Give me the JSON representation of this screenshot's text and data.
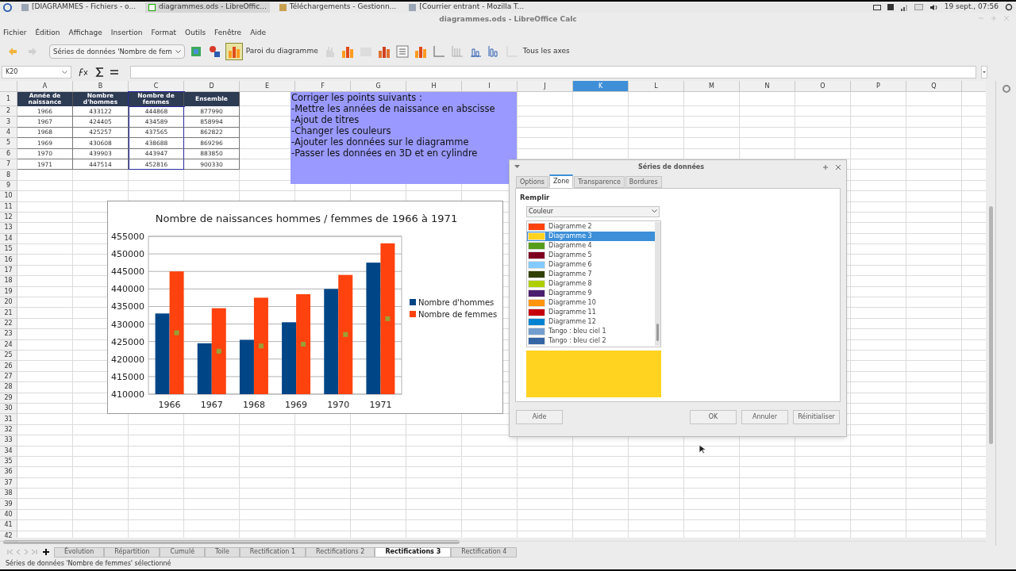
{
  "taskbar": {
    "windows": [
      {
        "label": "[DIAGRAMMES - Fichiers - o...",
        "selected": false
      },
      {
        "label": "diagrammes.ods - LibreOffic...",
        "selected": true
      },
      {
        "label": "Téléchargements - Gestionn...",
        "selected": false
      },
      {
        "label": "[Courrier entrant - Mozilla T...",
        "selected": false
      }
    ],
    "clock": "19 sept., 07:56"
  },
  "window": {
    "title": "diagrammes.ods - LibreOffice Calc"
  },
  "menu": [
    "Fichier",
    "Édition",
    "Affichage",
    "Insertion",
    "Format",
    "Outils",
    "Fenêtre",
    "Aide"
  ],
  "toolbar": {
    "element_select": "Séries de données 'Nombre de fem",
    "wall_label": "Paroi du diagramme",
    "axes_label": "Tous les axes"
  },
  "formula_bar": {
    "cell_ref": "K20"
  },
  "sheet": {
    "columns": [
      {
        "label": "A",
        "selected": false
      },
      {
        "label": "B",
        "selected": false
      },
      {
        "label": "C",
        "selected": false
      },
      {
        "label": "D",
        "selected": false
      },
      {
        "label": "E",
        "selected": false
      },
      {
        "label": "F",
        "selected": false
      },
      {
        "label": "G",
        "selected": false
      },
      {
        "label": "H",
        "selected": false
      },
      {
        "label": "I",
        "selected": false
      },
      {
        "label": "J",
        "selected": false
      },
      {
        "label": "K",
        "selected": true
      },
      {
        "label": "L",
        "selected": false
      },
      {
        "label": "M",
        "selected": false
      },
      {
        "label": "N",
        "selected": false
      },
      {
        "label": "O",
        "selected": false
      },
      {
        "label": "P",
        "selected": false
      },
      {
        "label": "Q",
        "selected": false
      }
    ],
    "rows": [
      "1",
      "2",
      "3",
      "4",
      "5",
      "6",
      "7",
      "8",
      "9",
      "10",
      "11",
      "12",
      "13",
      "14",
      "15",
      "16",
      "17",
      "18",
      "19",
      "20",
      "21",
      "22",
      "23",
      "24",
      "25",
      "26",
      "27",
      "28",
      "29",
      "30",
      "31",
      "32",
      "33",
      "34",
      "35",
      "36",
      "37",
      "38",
      "39",
      "40",
      "41",
      "42"
    ],
    "table": {
      "header": [
        "Année de naissance",
        "Nombre d'hommes",
        "Nombre de femmes",
        "Ensemble"
      ],
      "body": [
        [
          "1966",
          "433122",
          "444868",
          "877990"
        ],
        [
          "1967",
          "424405",
          "434589",
          "858994"
        ],
        [
          "1968",
          "425257",
          "437565",
          "862822"
        ],
        [
          "1969",
          "430608",
          "438688",
          "869296"
        ],
        [
          "1970",
          "439903",
          "443947",
          "883850"
        ],
        [
          "1971",
          "447514",
          "452816",
          "900330"
        ]
      ]
    },
    "note": [
      "Corriger les points suivants :",
      "-Mettre les années de naissance en abscisse",
      "-Ajout de titres",
      "-Changer les couleurs",
      "-Ajouter les données sur le diagramme",
      "-Passer les données en 3D et en cylindre"
    ],
    "chart": {
      "chart_data": {
        "type": "bar",
        "title": "Nombre de naissances hommes / femmes de 1966 à 1971",
        "categories": [
          "1966",
          "1967",
          "1968",
          "1969",
          "1970",
          "1971"
        ],
        "series": [
          {
            "name": "Nombre d'hommes",
            "color": "#004586",
            "values": [
              433000,
              424500,
              425500,
              430500,
              440000,
              447500
            ]
          },
          {
            "name": "Nombre de femmes",
            "color": "#ff420e",
            "values": [
              445000,
              434500,
              437500,
              438500,
              444000,
              453000
            ]
          }
        ],
        "grid": true,
        "legend": true,
        "ylim": [
          410000,
          455000
        ],
        "yticks": [
          410000,
          415000,
          420000,
          425000,
          430000,
          435000,
          440000,
          445000,
          450000,
          455000
        ]
      }
    }
  },
  "dialog": {
    "title": "Séries de données",
    "tabs": [
      {
        "label": "Options",
        "selected": false
      },
      {
        "label": "Zone",
        "selected": true
      },
      {
        "label": "Transparence",
        "selected": false
      },
      {
        "label": "Bordures",
        "selected": false
      }
    ],
    "section": "Remplir",
    "fill_type": "Couleur",
    "colors": [
      {
        "name": "Diagramme 2",
        "color": "#ff420e",
        "selected": false
      },
      {
        "name": "Diagramme 3",
        "color": "#ffd320",
        "selected": true
      },
      {
        "name": "Diagramme 4",
        "color": "#579d1c",
        "selected": false
      },
      {
        "name": "Diagramme 5",
        "color": "#7e0021",
        "selected": false
      },
      {
        "name": "Diagramme 6",
        "color": "#83caff",
        "selected": false
      },
      {
        "name": "Diagramme 7",
        "color": "#314004",
        "selected": false
      },
      {
        "name": "Diagramme 8",
        "color": "#aecf00",
        "selected": false
      },
      {
        "name": "Diagramme 9",
        "color": "#4b1f6f",
        "selected": false
      },
      {
        "name": "Diagramme 10",
        "color": "#ff950e",
        "selected": false
      },
      {
        "name": "Diagramme 11",
        "color": "#c5000b",
        "selected": false
      },
      {
        "name": "Diagramme 12",
        "color": "#0084d1",
        "selected": false
      },
      {
        "name": "Tango : bleu ciel 1",
        "color": "#729fcf",
        "selected": false
      },
      {
        "name": "Tango : bleu ciel 2",
        "color": "#3465a4",
        "selected": false
      }
    ],
    "buttons": [
      "Aide",
      "OK",
      "Annuler",
      "Réinitialiser"
    ]
  },
  "sheet_tabs": [
    {
      "label": "Évolution",
      "selected": false
    },
    {
      "label": "Répartition",
      "selected": false
    },
    {
      "label": "Cumulé",
      "selected": false
    },
    {
      "label": "Toile",
      "selected": false
    },
    {
      "label": "Rectification 1",
      "selected": false
    },
    {
      "label": "Rectifications 2",
      "selected": false
    },
    {
      "label": "Rectifications 3",
      "selected": true
    },
    {
      "label": "Rectification 4",
      "selected": false
    }
  ],
  "status_bar": "Séries de données 'Nombre de femmes' sélectionné"
}
